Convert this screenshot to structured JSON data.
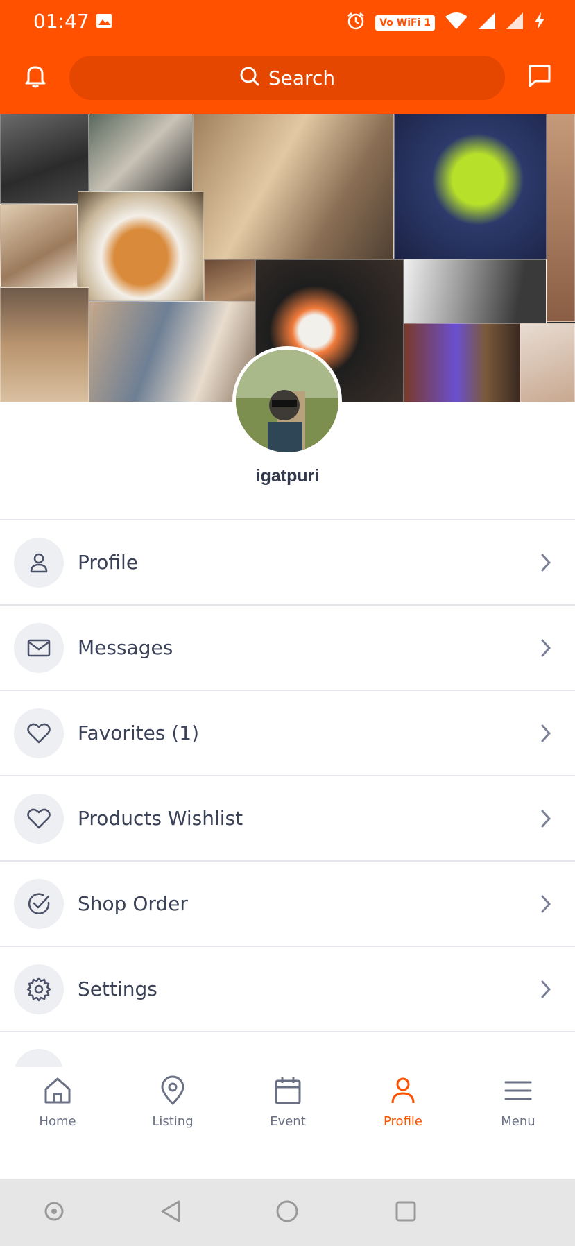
{
  "status_bar": {
    "time": "01:47",
    "wifi_badge": "Vo WiFi 1",
    "icons": [
      "gallery-icon",
      "alarm-icon",
      "wifi-icon",
      "signal-icon",
      "signal-icon",
      "charging-icon"
    ]
  },
  "app_bar": {
    "search_placeholder": "Search",
    "left_icon": "bell-icon",
    "right_icon": "chat-icon"
  },
  "profile": {
    "username": "igatpuri"
  },
  "menu": {
    "items": [
      {
        "label": "Profile",
        "icon": "user-icon"
      },
      {
        "label": "Messages",
        "icon": "mail-icon"
      },
      {
        "label": "Favorites (1)",
        "icon": "heart-icon"
      },
      {
        "label": "Products Wishlist",
        "icon": "heart-icon"
      },
      {
        "label": "Shop Order",
        "icon": "check-circle-icon"
      },
      {
        "label": "Settings",
        "icon": "gear-icon"
      }
    ]
  },
  "bottom_nav": {
    "items": [
      {
        "label": "Home",
        "icon": "home-icon"
      },
      {
        "label": "Listing",
        "icon": "map-pin-icon"
      },
      {
        "label": "Event",
        "icon": "calendar-icon"
      },
      {
        "label": "Profile",
        "icon": "user-icon"
      },
      {
        "label": "Menu",
        "icon": "hamburger-icon"
      }
    ],
    "active": "Profile"
  },
  "colors": {
    "brand": "#ff5100",
    "search_bg": "#e54600",
    "text": "#3b4258",
    "icon": "#4a5068",
    "active": "#ff5100"
  }
}
